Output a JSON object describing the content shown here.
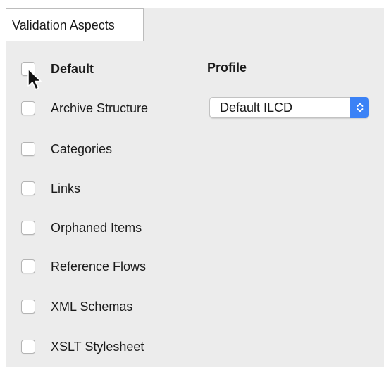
{
  "tabs": [
    {
      "label": "Validation Aspects",
      "active": true
    }
  ],
  "header": {
    "default_label": "Default",
    "profile_label": "Profile"
  },
  "aspects": [
    {
      "label": "Archive Structure",
      "checked": false
    },
    {
      "label": "Categories",
      "checked": false
    },
    {
      "label": "Links",
      "checked": false
    },
    {
      "label": "Orphaned Items",
      "checked": false
    },
    {
      "label": "Reference Flows",
      "checked": false
    },
    {
      "label": "XML Schemas",
      "checked": false
    },
    {
      "label": "XSLT Stylesheet",
      "checked": false
    }
  ],
  "profile": {
    "selected": "Default ILCD"
  },
  "icons": {
    "stepper": "chevron-up-down-icon",
    "cursor": "mouse-pointer-icon"
  },
  "colors": {
    "accent": "#3b82f6",
    "panel": "#ececec"
  }
}
